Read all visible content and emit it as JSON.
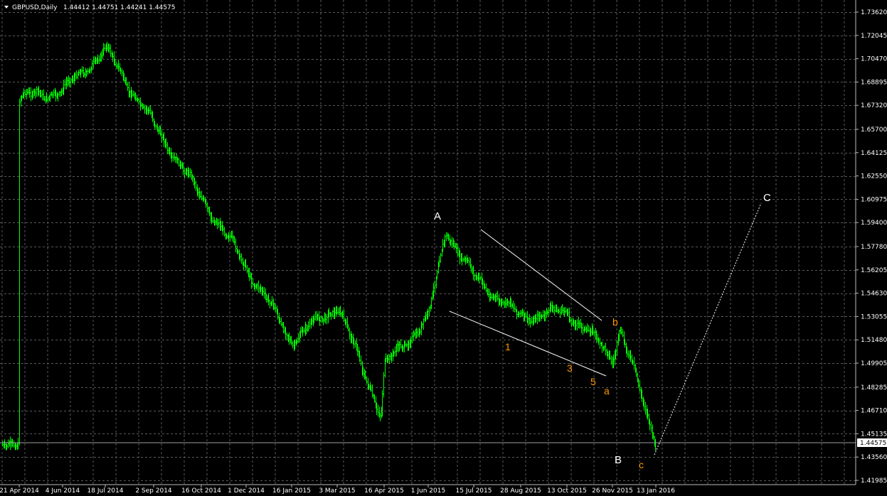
{
  "header": {
    "symbol": "GBPUSD,Daily",
    "ohlc": "1.44412 1.44751 1.44241 1.44575"
  },
  "colors": {
    "background": "#000000",
    "grid": "#5a5a5a",
    "bars": "#00ff00",
    "axis_text": "#ffffff",
    "wave_major": "#ffffff",
    "wave_minor": "#ff9900"
  },
  "chart_data": {
    "type": "bar",
    "title": "GBPUSD,Daily",
    "y_ticks": [
      "1.73620",
      "1.72045",
      "1.70470",
      "1.68895",
      "1.67320",
      "1.65700",
      "1.64125",
      "1.62550",
      "1.60975",
      "1.59400",
      "1.57780",
      "1.56205",
      "1.54630",
      "1.53055",
      "1.51480",
      "1.49905",
      "1.48285",
      "1.46710",
      "1.45135",
      "1.43560",
      "1.41985"
    ],
    "x_ticks": [
      "21 Apr 2014",
      "4 Jun 2014",
      "18 Jul 2014",
      "2 Sep 2014",
      "16 Oct 2014",
      "1 Dec 2014",
      "16 Jan 2015",
      "3 Mar 2015",
      "16 Apr 2015",
      "1 Jun 2015",
      "15 Jul 2015",
      "28 Aug 2015",
      "13 Oct 2015",
      "26 Nov 2015",
      "13 Jan 2016"
    ],
    "current_price": "1.44575",
    "ylim": [
      1.41985,
      1.7362
    ],
    "grid": true,
    "close_path": [
      [
        "21 Apr 2014",
        1.678
      ],
      [
        "4 Jun 2014",
        1.683
      ],
      [
        "18 Jul 2014",
        1.711
      ],
      [
        "2 Sep 2014",
        1.66
      ],
      [
        "16 Oct 2014",
        1.611
      ],
      [
        "1 Dec 2014",
        1.564
      ],
      [
        "16 Jan 2015",
        1.514
      ],
      [
        "3 Mar 2015",
        1.538
      ],
      [
        "13 Apr 2015",
        1.464
      ],
      [
        "16 Apr 2015",
        1.497
      ],
      [
        "1 Jun 2015",
        1.53
      ],
      [
        "18 Jun 2015",
        1.589
      ],
      [
        "15 Jul 2015",
        1.557
      ],
      [
        "28 Aug 2015",
        1.53
      ],
      [
        "13 Oct 2015",
        1.534
      ],
      [
        "26 Nov 2015",
        1.503
      ],
      [
        "4 Dec 2015",
        1.522
      ],
      [
        "13 Jan 2016",
        1.446
      ]
    ],
    "projection": {
      "from": [
        "13 Jan 2016",
        1.4395
      ],
      "to": [
        "C",
        1.608
      ]
    },
    "wave_labels_major": [
      {
        "text": "A",
        "date": "18 Jun 2015",
        "price": 1.596
      },
      {
        "text": "B",
        "date": "13 Jan 2016",
        "price": 1.4363
      },
      {
        "text": "C",
        "date": "projection",
        "price": 1.61
      }
    ],
    "wave_labels_minor": [
      {
        "text": "1",
        "date": "28 Aug 2015",
        "price": 1.512
      },
      {
        "text": "3",
        "date": "13 Oct 2015",
        "price": 1.4982
      },
      {
        "text": "5",
        "date": "26 Nov 2015",
        "price": 1.4858
      },
      {
        "text": "a",
        "date": "26 Nov 2015",
        "price": 1.4813
      },
      {
        "text": "b",
        "date": "4 Dec 2015",
        "price": 1.529
      },
      {
        "text": "c",
        "date": "13 Jan 2016",
        "price": 1.4343
      }
    ]
  }
}
